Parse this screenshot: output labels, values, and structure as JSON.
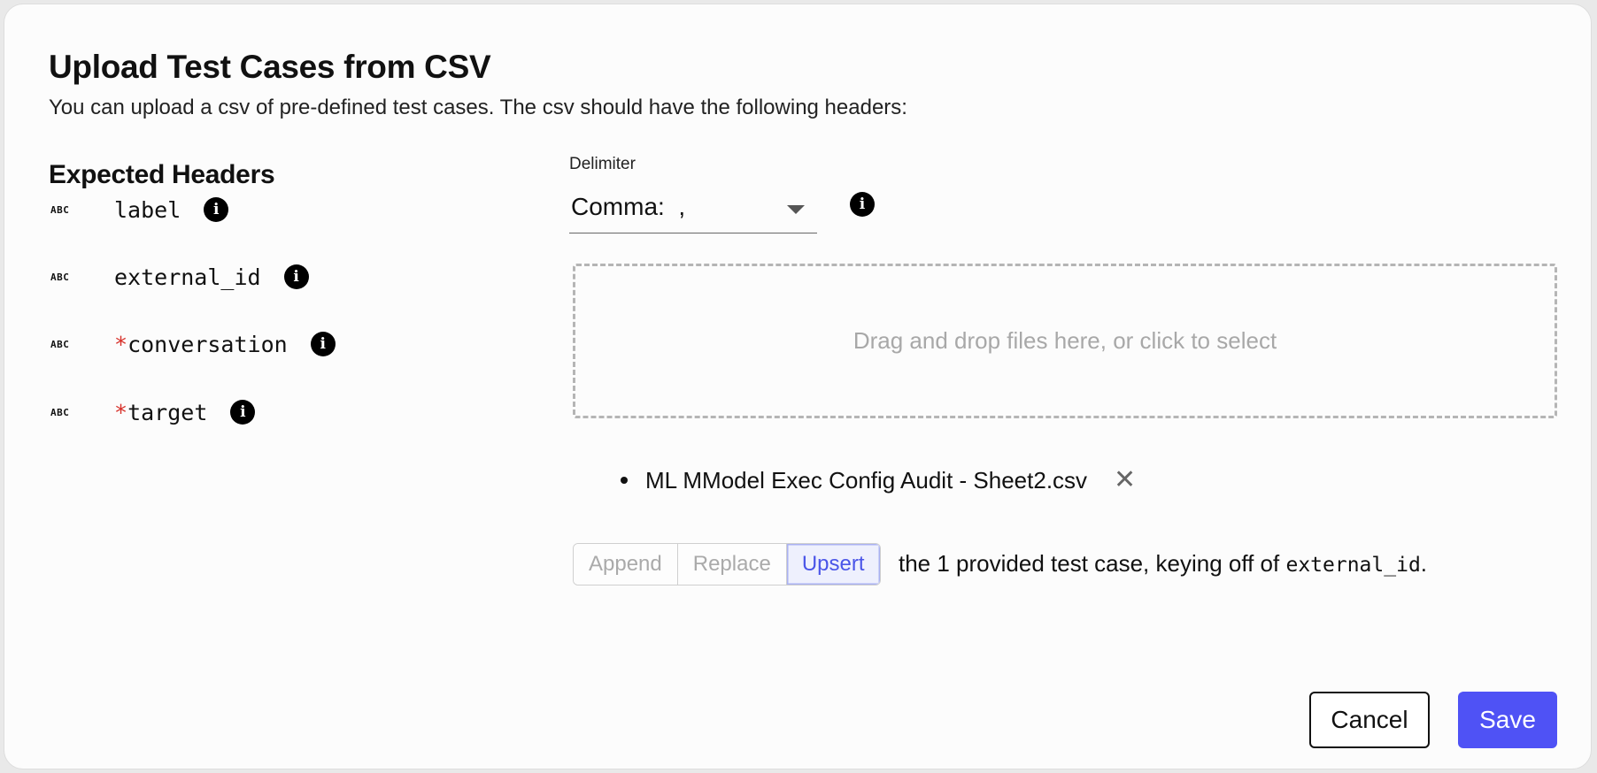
{
  "dialog": {
    "title": "Upload Test Cases from CSV",
    "subtitle": "You can upload a csv of pre-defined test cases. The csv should have the following headers:"
  },
  "expected_headers": {
    "title": "Expected Headers",
    "type_badge": "ABC",
    "items": [
      {
        "name": "label",
        "required": false
      },
      {
        "name": "external_id",
        "required": false
      },
      {
        "name": "conversation",
        "required": true,
        "required_marker": "*"
      },
      {
        "name": "target",
        "required": true,
        "required_marker": "*"
      }
    ]
  },
  "delimiter": {
    "label": "Delimiter",
    "selected": "Comma:  ,"
  },
  "dropzone": {
    "text": "Drag and drop files here, or click to select"
  },
  "files": [
    {
      "name": "ML MModel Exec Config Audit - Sheet2.csv",
      "remove_icon": "close-icon"
    }
  ],
  "upload_mode": {
    "options": [
      "Append",
      "Replace",
      "Upsert"
    ],
    "selected": "Upsert",
    "description_prefix": "the 1 provided test case, keying off of ",
    "description_key": "external_id",
    "description_suffix": "."
  },
  "actions": {
    "cancel_label": "Cancel",
    "save_label": "Save"
  },
  "colors": {
    "accent": "#4f52f5",
    "required_marker": "#d7312a",
    "active_mode_text": "#4a55e8"
  }
}
